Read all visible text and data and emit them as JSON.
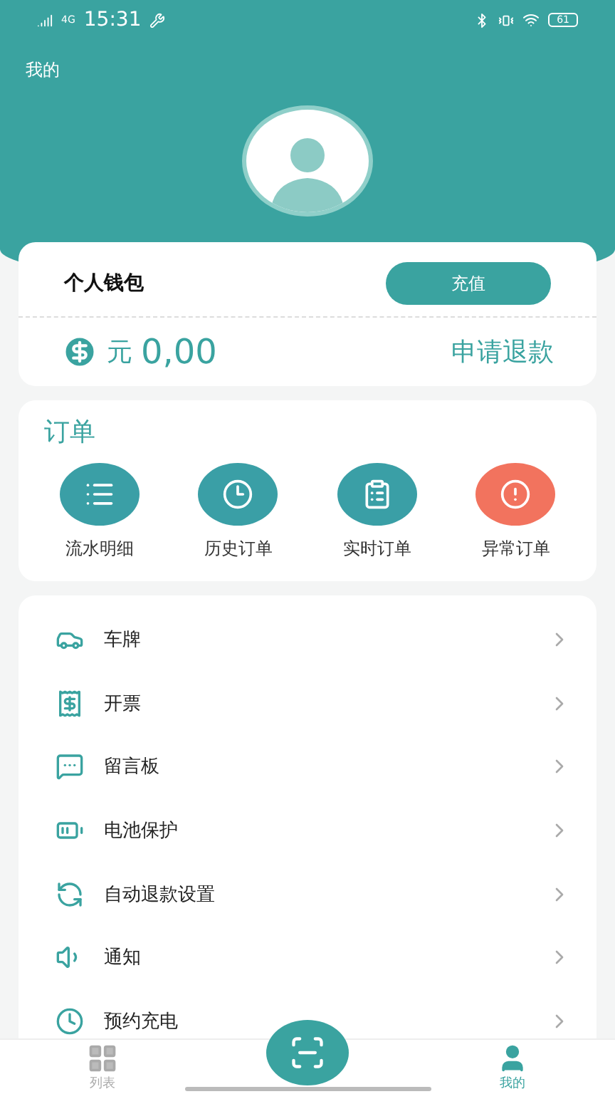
{
  "status_bar": {
    "network": "4G",
    "time": "15:31",
    "battery": "61"
  },
  "header": {
    "title": "我的"
  },
  "wallet": {
    "title": "个人钱包",
    "recharge_button": "充值",
    "currency": "元",
    "balance": "0,00",
    "refund_link": "申请退款"
  },
  "orders": {
    "title": "订单",
    "items": [
      {
        "label": "流水明细",
        "color": "#3a9fa6"
      },
      {
        "label": "历史订单",
        "color": "#3a9fa6"
      },
      {
        "label": "实时订单",
        "color": "#3a9fa6"
      },
      {
        "label": "异常订单",
        "color": "#f2735e"
      }
    ]
  },
  "menu": [
    {
      "label": "车牌"
    },
    {
      "label": "开票"
    },
    {
      "label": "留言板"
    },
    {
      "label": "电池保护"
    },
    {
      "label": "自动退款设置"
    },
    {
      "label": "通知"
    },
    {
      "label": "预约充电"
    }
  ],
  "tab_bar": [
    {
      "label": "列表",
      "selected": false
    },
    {
      "label": "我的",
      "selected": true
    }
  ]
}
